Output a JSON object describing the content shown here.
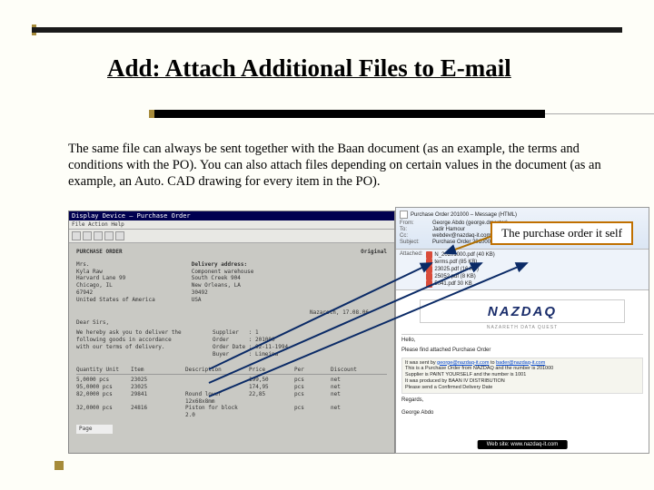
{
  "title": "Add: Attach Additional Files to E-mail",
  "description": "The same file can always be sent together with the Baan document (as an example, the terms and conditions with the PO). You can also attach files depending on certain values in the document (as an example, an Auto. CAD drawing for every item in the PO).",
  "callout": "The purchase order it self",
  "baan": {
    "title": "Display Device – Purchase Order",
    "menu": "File   Action   Help",
    "header": "PURCHASE ORDER",
    "original": "Original",
    "addr": {
      "left": [
        "Mrs.",
        "Kyla Raw",
        "Harvard Lane 99",
        "Chicago, IL",
        "67942",
        "United States of America"
      ],
      "rightLabel": "Delivery address:",
      "right": [
        "Component warehouse",
        "South Creek 904",
        "New Orleans, LA",
        "30492",
        "USA"
      ]
    },
    "place": "Nazareth, 17.08.06",
    "salutation": "Dear Sirs,",
    "intro": "We hereby ask you to deliver the following goods in accordance with our terms of delivery.",
    "meta": {
      "Supplier": "1",
      "Order": "201000",
      "Order Date": "02-11-1994",
      "Buyer": "Limeina"
    },
    "tableHead": [
      "Quantity Unit",
      "Item",
      "Description",
      "Price",
      "Per",
      "Discount"
    ],
    "rows": [
      [
        "5,0000 pcs",
        "23025",
        "",
        "199,50",
        "pcs",
        "net"
      ],
      [
        "95,0000 pcs",
        "23025",
        "",
        "174,95",
        "pcs",
        "net"
      ],
      [
        "82,0000 pcs",
        "29841",
        "Round lower 12x68x8mm",
        "22,85",
        "pcs",
        "net"
      ],
      [
        "32,0000 pcs",
        "24816",
        "Piston for block 2.0",
        "",
        "pcs",
        "net"
      ]
    ],
    "pager": "Page"
  },
  "email": {
    "windowTitle": "Purchase Order  201000  – Message (HTML)",
    "from": "George Abdo (george.dmaster)",
    "to": "Jadir Hamour",
    "cc": "webdev@nazdaq-it.com",
    "subject": "Purchase Order  201000",
    "attachLabel": "Attached:",
    "attachments": [
      {
        "name": "N_20201000.pdf (40 KB)",
        "cls": "pdf"
      },
      {
        "name": "terms.pdf (85 KB)",
        "cls": "pdf"
      },
      {
        "name": "23025.pdf (16 KB)",
        "cls": "pdf"
      },
      {
        "name": "25052.pdf (8 KB)",
        "cls": "pdf"
      },
      {
        "name": "5041.pdf 30 KB",
        "cls": "pdf"
      }
    ],
    "logo": "NAZDAQ",
    "tagline": "NAZARETH DATA QUEST",
    "greeting": "Hello,",
    "line1": "Please find attached Purchase Order",
    "info": [
      "It was sent by george@nazdaq-it.com to bader@nazdaq-it.com",
      "This is a Purchase Order from NAZDAQ and the number is 201000",
      "Supplier is PAINT YOURSELF and the number is 1001",
      "It was produced by BAAN IV DISTRIBUTION",
      "Please send a Confirmed Delivery Date"
    ],
    "regards": "Regards,",
    "signature": "George Abdo",
    "footer": "Web site: www.nazdaq-it.com"
  }
}
